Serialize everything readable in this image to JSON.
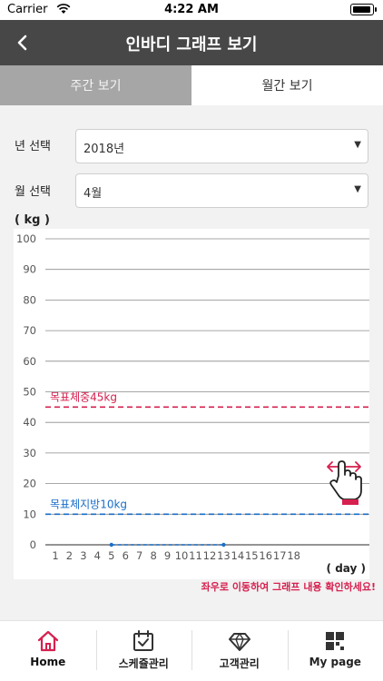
{
  "status_bar": {
    "carrier": "Carrier",
    "time": "4:22 AM",
    "wifi_icon": "wifi-icon",
    "battery_icon": "battery-icon"
  },
  "header": {
    "title": "인바디 그래프 보기",
    "back_icon": "chevron-left-icon"
  },
  "tabs": [
    {
      "label": "주간 보기",
      "selected": false
    },
    {
      "label": "월간 보기",
      "selected": true
    }
  ],
  "filters": {
    "year": {
      "label": "년 선택",
      "value": "2018년"
    },
    "month": {
      "label": "월 선택",
      "value": "4월"
    }
  },
  "chart_data": {
    "type": "line",
    "ylabel": "( kg )",
    "xlabel": "( day )",
    "ylim": [
      0,
      100
    ],
    "yticks": [
      0,
      10,
      20,
      30,
      40,
      50,
      60,
      70,
      80,
      90,
      100
    ],
    "x_ticks": [
      1,
      2,
      3,
      4,
      5,
      6,
      7,
      8,
      9,
      10,
      11,
      12,
      13,
      14,
      15,
      16,
      17,
      18
    ],
    "series": [
      {
        "x": [
          5,
          13
        ],
        "values": [
          0,
          0
        ],
        "color": "#1b6ec9"
      }
    ],
    "reference_lines": [
      {
        "label": "목표체중45kg",
        "value": 45,
        "color": "#d6204f"
      },
      {
        "label": "목표체지방10kg",
        "value": 10,
        "color": "#1b6ec9"
      }
    ],
    "grid": true,
    "scroll_hint_icon": "swipe-hand-icon"
  },
  "hint": "좌우로 이동하여 그래프 내용 확인하세요!",
  "colors": {
    "accent": "#d6204f",
    "header_bg": "#474747",
    "tab_inactive_bg": "#a6a6a6",
    "fat_line": "#1b6ec9"
  },
  "bottom_nav": [
    {
      "label": "Home",
      "icon": "home-icon",
      "active": true
    },
    {
      "label": "스케쥴관리",
      "icon": "calendar-check-icon",
      "active": false
    },
    {
      "label": "고객관리",
      "icon": "diamond-icon",
      "active": false
    },
    {
      "label": "My page",
      "icon": "grid-icon",
      "active": false
    }
  ]
}
